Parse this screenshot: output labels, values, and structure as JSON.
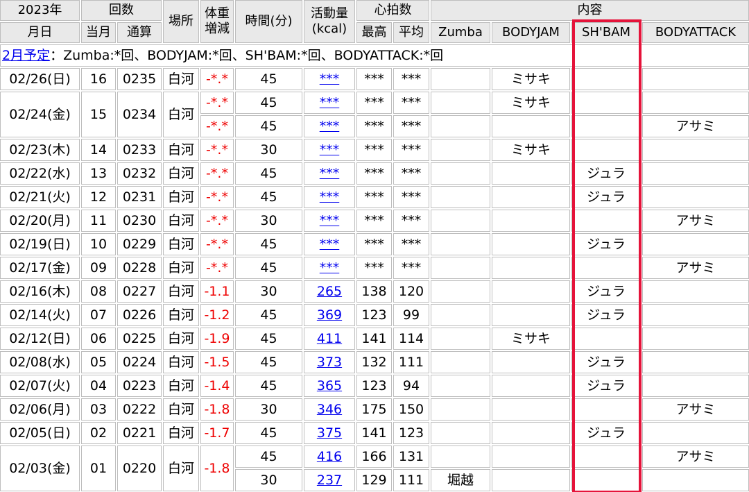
{
  "headers": {
    "year": "2023年",
    "date": "月日",
    "count": "回数",
    "count_month": "当月",
    "count_total": "通算",
    "place": "場所",
    "weight_1": "体重",
    "weight_2": "増減",
    "time": "時間(分)",
    "activity_1": "活動量",
    "activity_2": "(kcal)",
    "heart": "心拍数",
    "heart_max": "最高",
    "heart_avg": "平均",
    "content": "内容",
    "zumba": "Zumba",
    "bodyjam": "BODYJAM",
    "shbam": "SH'BAM",
    "bodyattack": "BODYATTACK"
  },
  "plan": {
    "link": "2月予定",
    "text": "：Zumba:*回、BODYJAM:*回、SH'BAM:*回、BODYATTACK:*回"
  },
  "rows": [
    {
      "date": "02/26(日)",
      "month": "16",
      "total": "0235",
      "place": "白河",
      "weight": "-*.*",
      "time": "45",
      "kcal": "***",
      "max": "***",
      "avg": "***",
      "zumba": "",
      "bodyjam": "ミサキ",
      "shbam": "",
      "bodyattack": ""
    },
    {
      "date": "02/24(金)",
      "month": "15",
      "total": "0234",
      "place": "白河",
      "weight": "-*.*",
      "time": "45",
      "kcal": "***",
      "max": "***",
      "avg": "***",
      "zumba": "",
      "bodyjam": "ミサキ",
      "shbam": "",
      "bodyattack": ""
    },
    {
      "weight": "-*.*",
      "time": "45",
      "kcal": "***",
      "max": "***",
      "avg": "***",
      "zumba": "",
      "bodyjam": "",
      "shbam": "",
      "bodyattack": "アサミ"
    },
    {
      "date": "02/23(木)",
      "month": "14",
      "total": "0233",
      "place": "白河",
      "weight": "-*.*",
      "time": "30",
      "kcal": "***",
      "max": "***",
      "avg": "***",
      "zumba": "",
      "bodyjam": "ミサキ",
      "shbam": "",
      "bodyattack": ""
    },
    {
      "date": "02/22(水)",
      "month": "13",
      "total": "0232",
      "place": "白河",
      "weight": "-*.*",
      "time": "45",
      "kcal": "***",
      "max": "***",
      "avg": "***",
      "zumba": "",
      "bodyjam": "",
      "shbam": "ジュラ",
      "bodyattack": ""
    },
    {
      "date": "02/21(火)",
      "month": "12",
      "total": "0231",
      "place": "白河",
      "weight": "-*.*",
      "time": "45",
      "kcal": "***",
      "max": "***",
      "avg": "***",
      "zumba": "",
      "bodyjam": "",
      "shbam": "ジュラ",
      "bodyattack": ""
    },
    {
      "date": "02/20(月)",
      "month": "11",
      "total": "0230",
      "place": "白河",
      "weight": "-*.*",
      "time": "30",
      "kcal": "***",
      "max": "***",
      "avg": "***",
      "zumba": "",
      "bodyjam": "",
      "shbam": "",
      "bodyattack": "アサミ"
    },
    {
      "date": "02/19(日)",
      "month": "10",
      "total": "0229",
      "place": "白河",
      "weight": "-*.*",
      "time": "45",
      "kcal": "***",
      "max": "***",
      "avg": "***",
      "zumba": "",
      "bodyjam": "",
      "shbam": "ジュラ",
      "bodyattack": ""
    },
    {
      "date": "02/17(金)",
      "month": "09",
      "total": "0228",
      "place": "白河",
      "weight": "-*.*",
      "time": "45",
      "kcal": "***",
      "max": "***",
      "avg": "***",
      "zumba": "",
      "bodyjam": "",
      "shbam": "",
      "bodyattack": "アサミ"
    },
    {
      "date": "02/16(木)",
      "month": "08",
      "total": "0227",
      "place": "白河",
      "weight": "-1.1",
      "time": "30",
      "kcal": "265",
      "max": "138",
      "avg": "120",
      "zumba": "",
      "bodyjam": "",
      "shbam": "ジュラ",
      "bodyattack": ""
    },
    {
      "date": "02/14(火)",
      "month": "07",
      "total": "0226",
      "place": "白河",
      "weight": "-1.2",
      "time": "45",
      "kcal": "369",
      "max": "123",
      "avg": "99",
      "zumba": "",
      "bodyjam": "",
      "shbam": "ジュラ",
      "bodyattack": ""
    },
    {
      "date": "02/12(日)",
      "month": "06",
      "total": "0225",
      "place": "白河",
      "weight": "-1.9",
      "time": "45",
      "kcal": "411",
      "max": "141",
      "avg": "114",
      "zumba": "",
      "bodyjam": "ミサキ",
      "shbam": "",
      "bodyattack": ""
    },
    {
      "date": "02/08(水)",
      "month": "05",
      "total": "0224",
      "place": "白河",
      "weight": "-1.5",
      "time": "45",
      "kcal": "373",
      "max": "132",
      "avg": "111",
      "zumba": "",
      "bodyjam": "",
      "shbam": "ジュラ",
      "bodyattack": ""
    },
    {
      "date": "02/07(火)",
      "month": "04",
      "total": "0223",
      "place": "白河",
      "weight": "-1.4",
      "time": "45",
      "kcal": "365",
      "max": "123",
      "avg": "94",
      "zumba": "",
      "bodyjam": "",
      "shbam": "ジュラ",
      "bodyattack": ""
    },
    {
      "date": "02/06(月)",
      "month": "03",
      "total": "0222",
      "place": "白河",
      "weight": "-1.8",
      "time": "30",
      "kcal": "346",
      "max": "175",
      "avg": "150",
      "zumba": "",
      "bodyjam": "",
      "shbam": "",
      "bodyattack": "アサミ"
    },
    {
      "date": "02/05(日)",
      "month": "02",
      "total": "0221",
      "place": "白河",
      "weight": "-1.7",
      "time": "45",
      "kcal": "375",
      "max": "141",
      "avg": "123",
      "zumba": "",
      "bodyjam": "",
      "shbam": "ジュラ",
      "bodyattack": ""
    },
    {
      "date": "02/03(金)",
      "month": "01",
      "total": "0220",
      "place": "白河",
      "weight": "-1.8",
      "time": "45",
      "kcal": "416",
      "max": "166",
      "avg": "131",
      "zumba": "",
      "bodyjam": "",
      "shbam": "",
      "bodyattack": "アサミ"
    },
    {
      "time": "30",
      "kcal": "237",
      "max": "129",
      "avg": "111",
      "zumba": "堀越",
      "bodyjam": "",
      "shbam": "",
      "bodyattack": ""
    }
  ],
  "highlight_color": "#e5133a"
}
